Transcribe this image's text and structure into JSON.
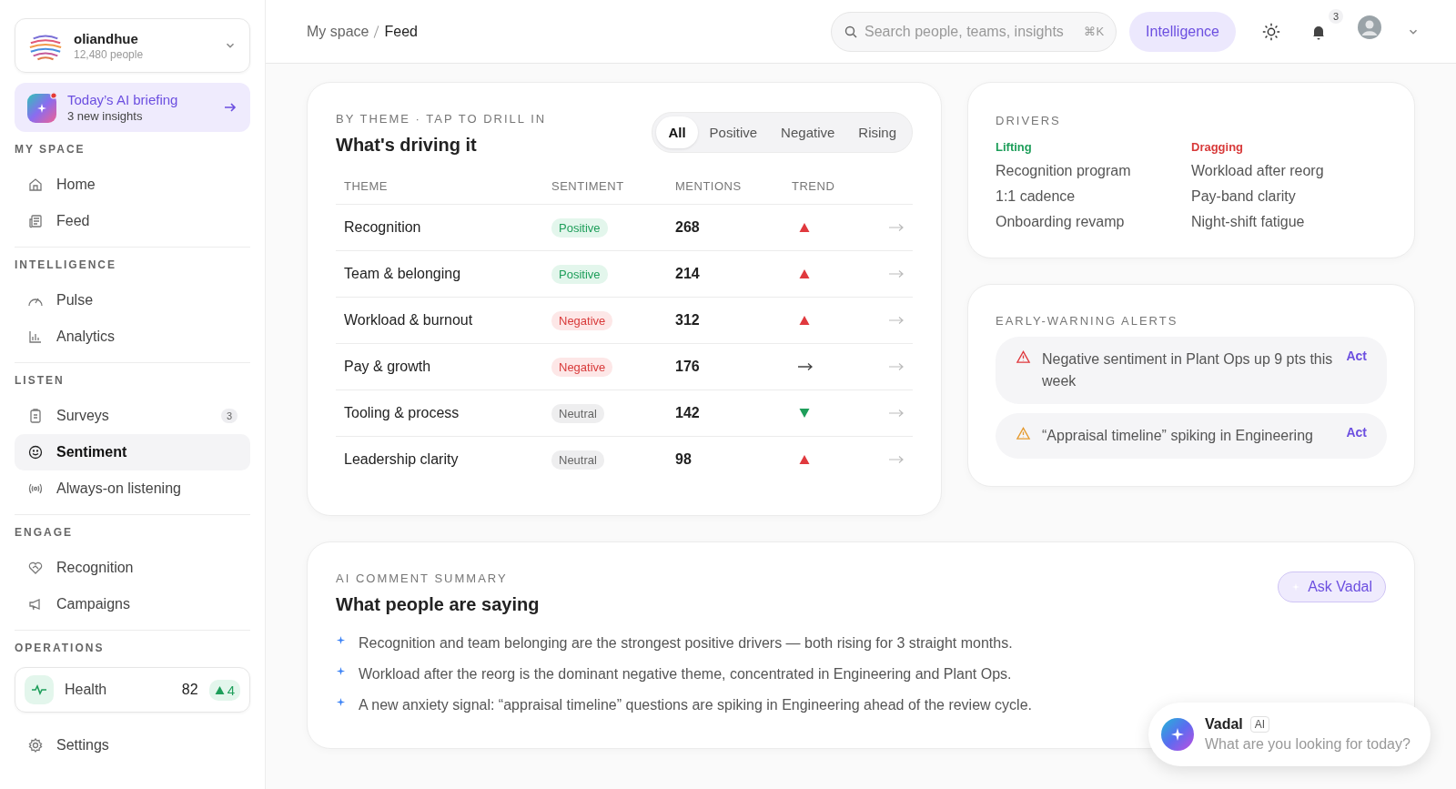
{
  "sidebar": {
    "org": {
      "name": "oliandhue",
      "count": "12,480 people"
    },
    "briefing": {
      "title": "Today’s AI briefing",
      "subtitle": "3 new insights"
    },
    "sections": [
      {
        "label": "MY SPACE",
        "items": [
          {
            "label": "Home",
            "selected": false
          },
          {
            "label": "Feed",
            "selected": false
          }
        ]
      },
      {
        "label": "INTELLIGENCE",
        "items": [
          {
            "label": "Pulse",
            "selected": false
          },
          {
            "label": "Analytics",
            "selected": false
          }
        ]
      },
      {
        "label": "LISTEN",
        "items": [
          {
            "label": "Surveys",
            "badge": "3",
            "selected": false
          },
          {
            "label": "Sentiment",
            "selected": true
          },
          {
            "label": "Always-on listening",
            "selected": false
          }
        ]
      },
      {
        "label": "ENGAGE",
        "items": [
          {
            "label": "Recognition",
            "selected": false
          },
          {
            "label": "Campaigns",
            "selected": false
          }
        ]
      },
      {
        "label": "OPERATIONS"
      }
    ],
    "health": {
      "label": "Health",
      "value": "82",
      "delta": "4"
    },
    "settings": "Settings"
  },
  "topbar": {
    "breadcrumb": [
      "My space",
      "Feed"
    ],
    "search": {
      "placeholder": "Search people, teams, insights",
      "shortcut": "⌘K"
    },
    "intelligence": "Intelligence",
    "notifications": "3"
  },
  "themes": {
    "eyebrow": "BY THEME · TAP TO DRILL IN",
    "title": "What's driving it",
    "filters": [
      {
        "label": "All",
        "selected": true
      },
      {
        "label": "Positive",
        "selected": false
      },
      {
        "label": "Negative",
        "selected": false
      },
      {
        "label": "Rising",
        "selected": false
      }
    ],
    "columns": [
      "THEME",
      "SENTIMENT",
      "MENTIONS",
      "TREND"
    ],
    "rows": [
      {
        "theme": "Recognition",
        "sentiment": {
          "label": "Positive",
          "kind": "positive"
        },
        "mentions": "268",
        "trend": {
          "kind": "up"
        }
      },
      {
        "theme": "Team & belonging",
        "sentiment": {
          "label": "Positive",
          "kind": "positive"
        },
        "mentions": "214",
        "trend": {
          "kind": "up"
        }
      },
      {
        "theme": "Workload & burnout",
        "sentiment": {
          "label": "Negative",
          "kind": "negative"
        },
        "mentions": "312",
        "trend": {
          "kind": "up"
        }
      },
      {
        "theme": "Pay & growth",
        "sentiment": {
          "label": "Negative",
          "kind": "negative"
        },
        "mentions": "176",
        "trend": {
          "kind": "flat"
        }
      },
      {
        "theme": "Tooling & process",
        "sentiment": {
          "label": "Neutral",
          "kind": "neutral"
        },
        "mentions": "142",
        "trend": {
          "kind": "down"
        }
      },
      {
        "theme": "Leadership clarity",
        "sentiment": {
          "label": "Neutral",
          "kind": "neutral"
        },
        "mentions": "98",
        "trend": {
          "kind": "up"
        }
      }
    ]
  },
  "drivers": {
    "eyebrow": "DRIVERS",
    "lifting": {
      "label": "Lifting",
      "items": [
        "Recognition program",
        "1:1 cadence",
        "Onboarding revamp"
      ]
    },
    "dragging": {
      "label": "Dragging",
      "items": [
        "Workload after reorg",
        "Pay-band clarity",
        "Night-shift fatigue"
      ]
    }
  },
  "alerts": {
    "eyebrow": "EARLY-WARNING ALERTS",
    "items": [
      {
        "kind": "danger",
        "text": "Negative sentiment in Plant Ops up 9 pts this week",
        "action": "Act"
      },
      {
        "kind": "warning",
        "text": "“Appraisal timeline” spiking in Engineering",
        "action": "Act"
      }
    ]
  },
  "summary": {
    "eyebrow": "AI COMMENT SUMMARY",
    "title": "What people are saying",
    "button": "Ask Vadal",
    "bullets": [
      "Recognition and team belonging are the strongest positive drivers — both rising for 3 straight months.",
      "Workload after the reorg is the dominant negative theme, concentrated in Engineering and Plant Ops.",
      "A new anxiety signal: “appraisal timeline” questions are spiking in Engineering ahead of the review cycle."
    ]
  },
  "assistant": {
    "name": "Vadal",
    "badge": "AI",
    "prompt": "What are you looking for today?"
  }
}
